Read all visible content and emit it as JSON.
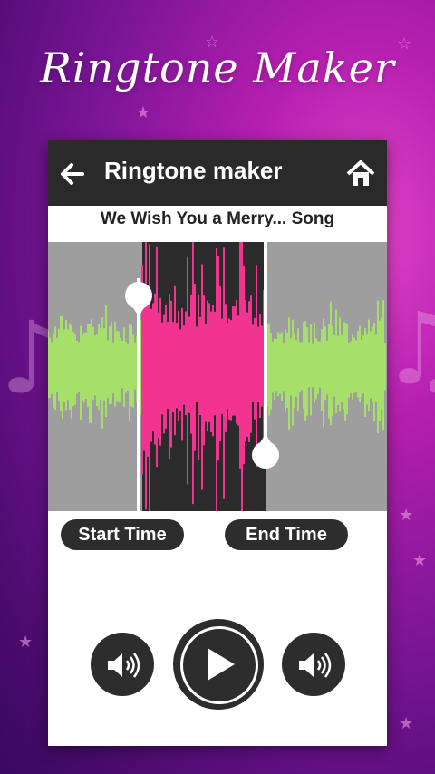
{
  "promo": {
    "headline": "Ringtone Maker"
  },
  "app": {
    "title": "Ringtone maker",
    "song_title": "We Wish You a Merry... Song"
  },
  "labels": {
    "start_time": "Start Time",
    "end_time": "End Time"
  },
  "icons": {
    "back": "arrow-left-icon",
    "home": "home-icon",
    "volume_left": "volume-icon",
    "play": "play-icon",
    "volume_right": "volume-icon"
  },
  "colors": {
    "waveform_unselected": "#a6e06a",
    "waveform_selected": "#f2338f",
    "app_bar": "#2a2a2a"
  }
}
